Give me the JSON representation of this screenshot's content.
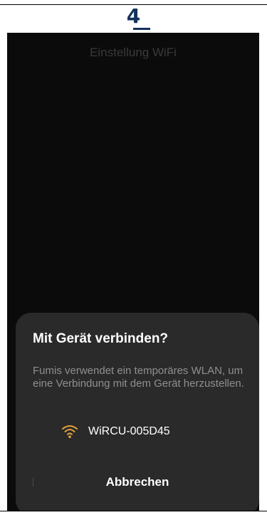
{
  "step": {
    "number": "4"
  },
  "screen": {
    "title": "Einstellung WiFi"
  },
  "dialog": {
    "title": "Mit Gerät verbinden?",
    "description": "Fumis verwendet ein temporäres WLAN, um eine Verbindung mit dem Gerät herzustellen.",
    "network": {
      "icon": "wifi-icon",
      "name": "WiRCU-005D45"
    },
    "cancel_label": "Abbrechen"
  },
  "colors": {
    "accent_wifi": "#e6a23c",
    "step_number": "#13315a",
    "sheet_background": "#2a2a2a",
    "screen_background": "#0b0b0b"
  }
}
